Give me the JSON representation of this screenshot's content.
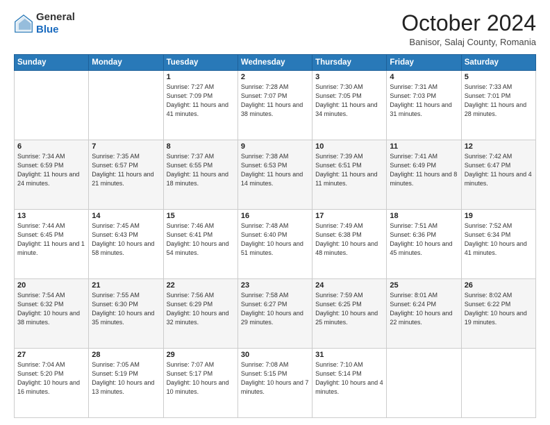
{
  "header": {
    "logo": {
      "line1": "General",
      "line2": "Blue"
    },
    "title": "October 2024",
    "subtitle": "Banisor, Salaj County, Romania"
  },
  "weekdays": [
    "Sunday",
    "Monday",
    "Tuesday",
    "Wednesday",
    "Thursday",
    "Friday",
    "Saturday"
  ],
  "weeks": [
    [
      null,
      null,
      {
        "day": 1,
        "sunrise": "7:27 AM",
        "sunset": "7:09 PM",
        "daylight": "11 hours and 41 minutes."
      },
      {
        "day": 2,
        "sunrise": "7:28 AM",
        "sunset": "7:07 PM",
        "daylight": "11 hours and 38 minutes."
      },
      {
        "day": 3,
        "sunrise": "7:30 AM",
        "sunset": "7:05 PM",
        "daylight": "11 hours and 34 minutes."
      },
      {
        "day": 4,
        "sunrise": "7:31 AM",
        "sunset": "7:03 PM",
        "daylight": "11 hours and 31 minutes."
      },
      {
        "day": 5,
        "sunrise": "7:33 AM",
        "sunset": "7:01 PM",
        "daylight": "11 hours and 28 minutes."
      }
    ],
    [
      {
        "day": 6,
        "sunrise": "7:34 AM",
        "sunset": "6:59 PM",
        "daylight": "11 hours and 24 minutes."
      },
      {
        "day": 7,
        "sunrise": "7:35 AM",
        "sunset": "6:57 PM",
        "daylight": "11 hours and 21 minutes."
      },
      {
        "day": 8,
        "sunrise": "7:37 AM",
        "sunset": "6:55 PM",
        "daylight": "11 hours and 18 minutes."
      },
      {
        "day": 9,
        "sunrise": "7:38 AM",
        "sunset": "6:53 PM",
        "daylight": "11 hours and 14 minutes."
      },
      {
        "day": 10,
        "sunrise": "7:39 AM",
        "sunset": "6:51 PM",
        "daylight": "11 hours and 11 minutes."
      },
      {
        "day": 11,
        "sunrise": "7:41 AM",
        "sunset": "6:49 PM",
        "daylight": "11 hours and 8 minutes."
      },
      {
        "day": 12,
        "sunrise": "7:42 AM",
        "sunset": "6:47 PM",
        "daylight": "11 hours and 4 minutes."
      }
    ],
    [
      {
        "day": 13,
        "sunrise": "7:44 AM",
        "sunset": "6:45 PM",
        "daylight": "11 hours and 1 minute."
      },
      {
        "day": 14,
        "sunrise": "7:45 AM",
        "sunset": "6:43 PM",
        "daylight": "10 hours and 58 minutes."
      },
      {
        "day": 15,
        "sunrise": "7:46 AM",
        "sunset": "6:41 PM",
        "daylight": "10 hours and 54 minutes."
      },
      {
        "day": 16,
        "sunrise": "7:48 AM",
        "sunset": "6:40 PM",
        "daylight": "10 hours and 51 minutes."
      },
      {
        "day": 17,
        "sunrise": "7:49 AM",
        "sunset": "6:38 PM",
        "daylight": "10 hours and 48 minutes."
      },
      {
        "day": 18,
        "sunrise": "7:51 AM",
        "sunset": "6:36 PM",
        "daylight": "10 hours and 45 minutes."
      },
      {
        "day": 19,
        "sunrise": "7:52 AM",
        "sunset": "6:34 PM",
        "daylight": "10 hours and 41 minutes."
      }
    ],
    [
      {
        "day": 20,
        "sunrise": "7:54 AM",
        "sunset": "6:32 PM",
        "daylight": "10 hours and 38 minutes."
      },
      {
        "day": 21,
        "sunrise": "7:55 AM",
        "sunset": "6:30 PM",
        "daylight": "10 hours and 35 minutes."
      },
      {
        "day": 22,
        "sunrise": "7:56 AM",
        "sunset": "6:29 PM",
        "daylight": "10 hours and 32 minutes."
      },
      {
        "day": 23,
        "sunrise": "7:58 AM",
        "sunset": "6:27 PM",
        "daylight": "10 hours and 29 minutes."
      },
      {
        "day": 24,
        "sunrise": "7:59 AM",
        "sunset": "6:25 PM",
        "daylight": "10 hours and 25 minutes."
      },
      {
        "day": 25,
        "sunrise": "8:01 AM",
        "sunset": "6:24 PM",
        "daylight": "10 hours and 22 minutes."
      },
      {
        "day": 26,
        "sunrise": "8:02 AM",
        "sunset": "6:22 PM",
        "daylight": "10 hours and 19 minutes."
      }
    ],
    [
      {
        "day": 27,
        "sunrise": "7:04 AM",
        "sunset": "5:20 PM",
        "daylight": "10 hours and 16 minutes."
      },
      {
        "day": 28,
        "sunrise": "7:05 AM",
        "sunset": "5:19 PM",
        "daylight": "10 hours and 13 minutes."
      },
      {
        "day": 29,
        "sunrise": "7:07 AM",
        "sunset": "5:17 PM",
        "daylight": "10 hours and 10 minutes."
      },
      {
        "day": 30,
        "sunrise": "7:08 AM",
        "sunset": "5:15 PM",
        "daylight": "10 hours and 7 minutes."
      },
      {
        "day": 31,
        "sunrise": "7:10 AM",
        "sunset": "5:14 PM",
        "daylight": "10 hours and 4 minutes."
      },
      null,
      null
    ]
  ]
}
